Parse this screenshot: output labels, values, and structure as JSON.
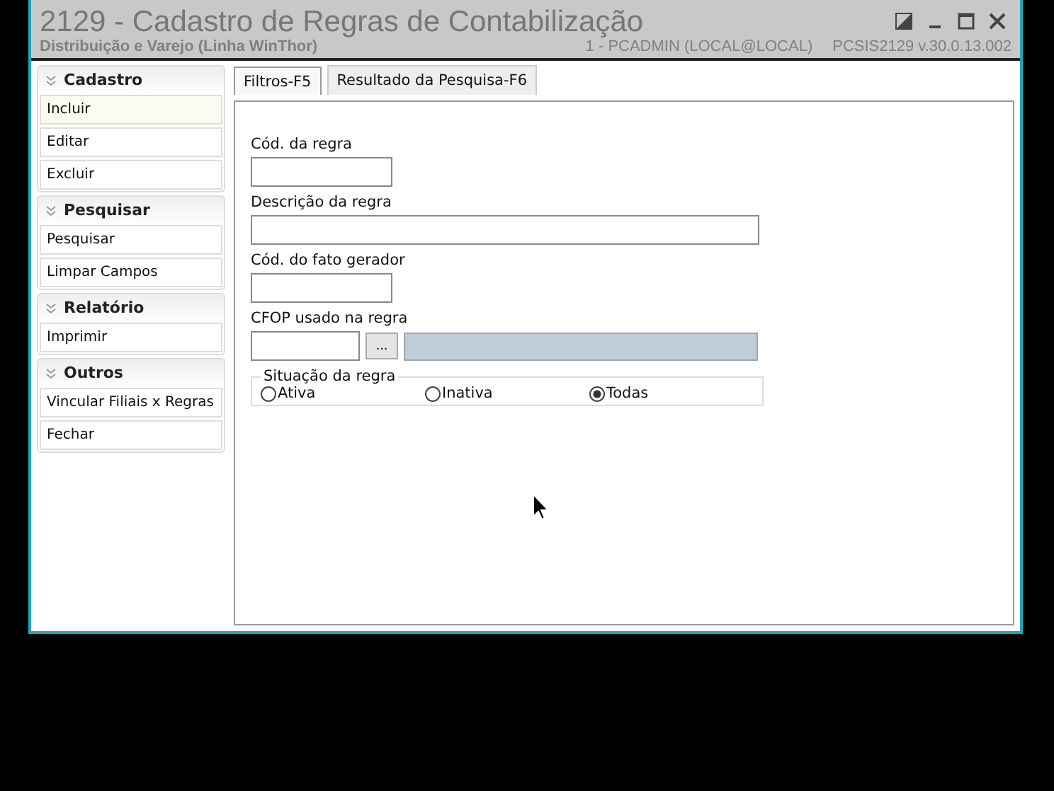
{
  "window": {
    "title": "2129 - Cadastro de Regras de Contabilização",
    "subtitle": "Distribuição e Varejo (Linha WinThor)",
    "user": "1 - PCADMIN (LOCAL@LOCAL)",
    "version": "PCSIS2129  v.30.0.13.002"
  },
  "sidebar": {
    "groups": [
      {
        "title": "Cadastro",
        "expanded": true,
        "items": [
          {
            "label": "Incluir",
            "selected": true
          },
          {
            "label": "Editar",
            "selected": false
          },
          {
            "label": "Excluir",
            "selected": false
          }
        ]
      },
      {
        "title": "Pesquisar",
        "expanded": true,
        "items": [
          {
            "label": "Pesquisar",
            "selected": false
          },
          {
            "label": "Limpar Campos",
            "selected": false
          }
        ]
      },
      {
        "title": "Relatório",
        "expanded": true,
        "items": [
          {
            "label": "Imprimir",
            "selected": false
          }
        ]
      },
      {
        "title": "Outros",
        "expanded": true,
        "items": [
          {
            "label": "Vincular Filiais x Regras",
            "selected": false
          },
          {
            "label": "Fechar",
            "selected": false
          }
        ]
      }
    ]
  },
  "tabs": [
    {
      "label": "Filtros-F5",
      "selected": true
    },
    {
      "label": "Resultado da Pesquisa-F6",
      "selected": false
    }
  ],
  "form": {
    "fields": [
      {
        "kind": "short",
        "label": "Cód. da regra"
      },
      {
        "kind": "wide",
        "label": "Descrição da regra"
      },
      {
        "kind": "short",
        "label": "Cód. do fato gerador"
      },
      {
        "kind": "lookup",
        "label": "CFOP usado na regra",
        "button": "..."
      }
    ],
    "situation": {
      "title": "Situação da regra",
      "options": [
        {
          "label": "Ativa",
          "selected": false
        },
        {
          "label": "Inativa",
          "selected": false
        },
        {
          "label": "Todas",
          "selected": true
        }
      ]
    }
  }
}
